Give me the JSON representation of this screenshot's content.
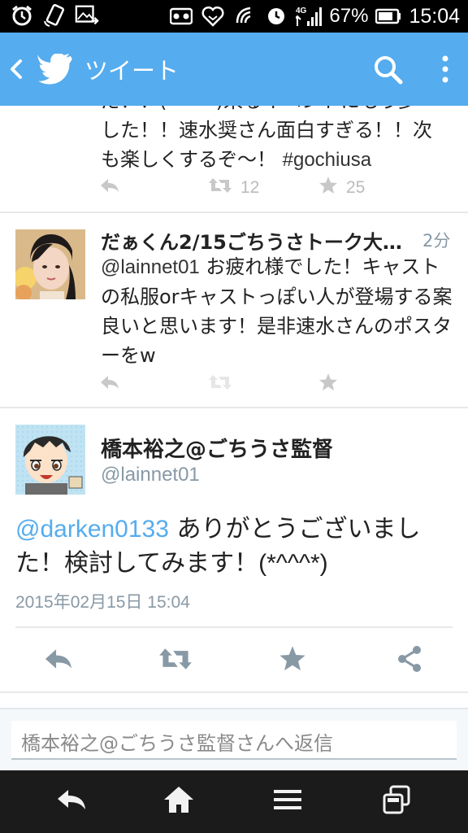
{
  "status_bar": {
    "battery_percent": "67%",
    "time": "15:04",
    "network": "4G",
    "icons_left": [
      "alarm-icon",
      "rotate-icon",
      "photo-icon"
    ],
    "icons_right": [
      "voicemail-icon",
      "heart-icon",
      "nfc-icon",
      "clock-icon",
      "signal-icon",
      "battery-icon"
    ]
  },
  "action_bar": {
    "title": "ツイート",
    "color": "#55acee"
  },
  "tweet1": {
    "text_line0": "だ！！(^^^)来るイベントにもう少",
    "text_line1": "した！！速水奨さん面白すぎる！！次",
    "text_line2": "も楽しくするぞ〜！ ",
    "hashtag": "#gochiusa",
    "retweets": "12",
    "favorites": "25"
  },
  "tweet2": {
    "name": "だぁくん2/15ごちうさトーク大…",
    "time": "2分",
    "mention": "@lainnet01",
    "text_after_mention": " お疲れ様でした！キャストの私服orキャストっぽい人が登場する案良いと思います！是非速水さんのポスターをw"
  },
  "main_tweet": {
    "name": "橋本裕之@ごちうさ監督",
    "handle": "@lainnet01",
    "mention": "@darken0133",
    "text": " ありがとうございました！検討してみます！",
    "emoticon": "(*^^^*)",
    "date": "2015年02月15日 15:04"
  },
  "reply": {
    "placeholder": "橋本裕之@ごちうさ監督さんへ返信"
  },
  "colors": {
    "accent": "#55acee",
    "muted": "#8899a6",
    "icon_gray": "#bbbbbb"
  }
}
